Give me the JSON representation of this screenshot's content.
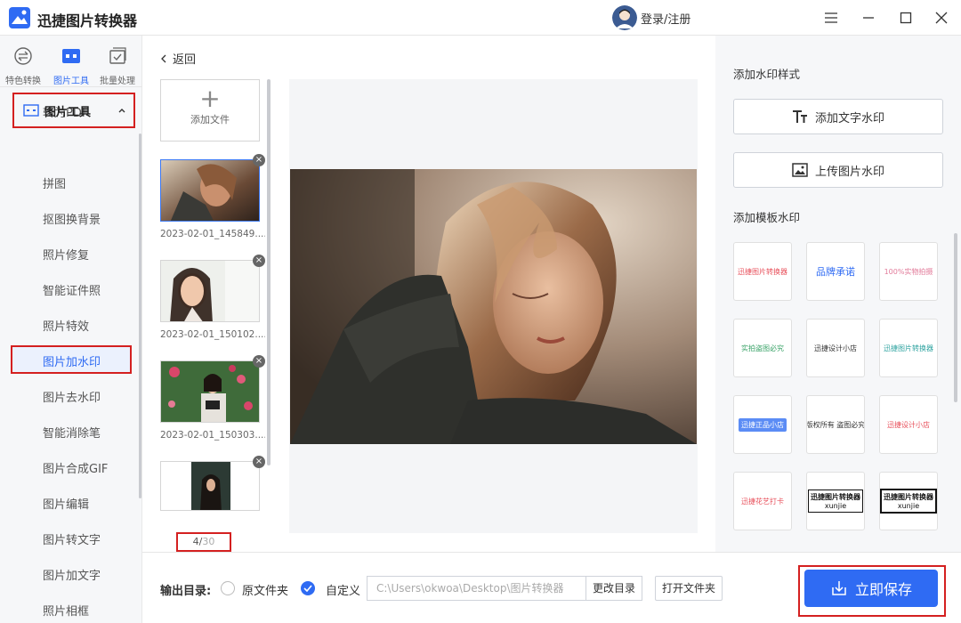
{
  "app": {
    "title": "迅捷图片转换器",
    "login": "登录/注册"
  },
  "top_nav": [
    {
      "label": "特色转换"
    },
    {
      "label": "图片工具"
    },
    {
      "label": "批量处理"
    }
  ],
  "sidebar": {
    "above_item": "转为PDF",
    "group_label": "图片工具",
    "items": [
      "拼图",
      "抠图换背景",
      "照片修复",
      "智能证件照",
      "照片特效",
      "图片加水印",
      "图片去水印",
      "智能消除笔",
      "图片合成GIF",
      "图片编辑",
      "图片转文字",
      "图片加文字",
      "照片相框"
    ]
  },
  "files": {
    "back": "返回",
    "add_file": "添加文件",
    "items": [
      {
        "name": "2023-02-01_145849...."
      },
      {
        "name": "2023-02-01_150102...."
      },
      {
        "name": "2023-02-01_150303...."
      }
    ],
    "counter_current": "4",
    "counter_total": "30"
  },
  "right": {
    "style_title": "添加水印样式",
    "text_wm": "添加文字水印",
    "image_wm": "上传图片水印",
    "template_title": "添加模板水印",
    "templates": [
      {
        "text": "迅捷图片转换器",
        "color": "#e8505b"
      },
      {
        "text": "品牌承诺",
        "color": "#2f6bf3"
      },
      {
        "text": "100%实物拍摄",
        "color": "#e27b9a"
      },
      {
        "text": "实拍盗图必究",
        "color": "#3aa368"
      },
      {
        "text": "迅捷设计小店",
        "color": "#333333"
      },
      {
        "text": "迅捷图片转换器",
        "color": "#2fa3a0"
      },
      {
        "text": "迅捷正品小店",
        "color": "#2f6bf3"
      },
      {
        "text": "版权所有 盗图必究",
        "color": "#333333"
      },
      {
        "text": "迅捷设计小店",
        "color": "#e8505b"
      },
      {
        "text": "迅捷花艺打卡",
        "color": "#e8505b"
      },
      {
        "text": "迅捷图片转换器",
        "sub": "xunjie",
        "color": "#111111"
      },
      {
        "text": "迅捷图片转换器",
        "sub": "xunjie",
        "color": "#111111"
      }
    ]
  },
  "bottom": {
    "output_label": "输出目录:",
    "opt_original": "原文件夹",
    "opt_custom": "自定义",
    "path": "C:\\Users\\okwoa\\Desktop\\图片转换器",
    "change_dir": "更改目录",
    "open_folder": "打开文件夹",
    "save": "立即保存"
  }
}
